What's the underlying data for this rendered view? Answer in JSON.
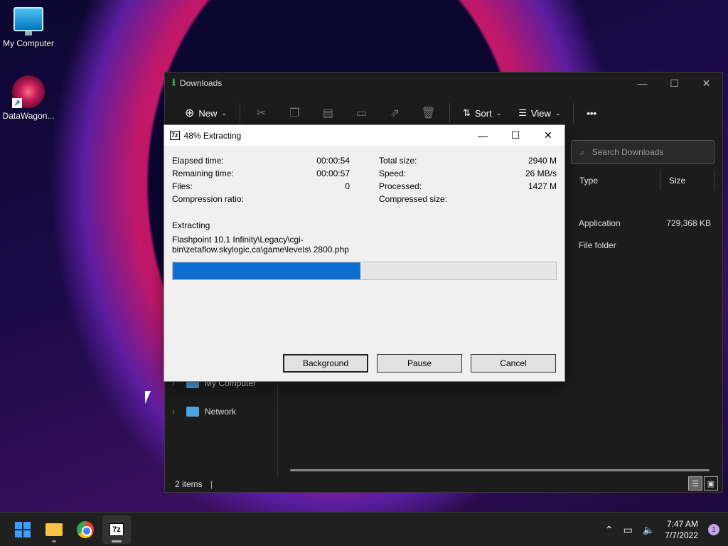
{
  "desktop": {
    "icons": [
      {
        "label": "My Computer"
      },
      {
        "label": "DataWagon..."
      }
    ]
  },
  "explorer": {
    "title": "Downloads",
    "toolbar": {
      "new_label": "New",
      "sort_label": "Sort",
      "view_label": "View",
      "more_label": "•••"
    },
    "search_placeholder": "Search Downloads",
    "columns": [
      "Type",
      "Size"
    ],
    "files": [
      {
        "type": "Application",
        "size": "729,368 KB"
      },
      {
        "type": "File folder",
        "size": ""
      }
    ],
    "nav": [
      {
        "label": "My Computer"
      },
      {
        "label": "Network"
      }
    ],
    "status": "2 items"
  },
  "dialog": {
    "title": "48% Extracting",
    "icon_text": "7z",
    "left_stats": [
      {
        "label": "Elapsed time:",
        "value": "00:00:54"
      },
      {
        "label": "Remaining time:",
        "value": "00:00:57"
      },
      {
        "label": "Files:",
        "value": "0"
      },
      {
        "label": "Compression ratio:",
        "value": ""
      }
    ],
    "right_stats": [
      {
        "label": "Total size:",
        "value": "2940 M"
      },
      {
        "label": "Speed:",
        "value": "26 MB/s"
      },
      {
        "label": "Processed:",
        "value": "1427 M"
      },
      {
        "label": "Compressed size:",
        "value": ""
      }
    ],
    "action_label": "Extracting",
    "current_path": "Flashpoint 10.1 Infinity\\Legacy\\cgi-bin\\zetaflow.skylogic.ca\\game\\levels\\ 2800.php",
    "progress_fraction": 0.49,
    "buttons": {
      "background": "Background",
      "pause": "Pause",
      "cancel": "Cancel"
    }
  },
  "taskbar": {
    "apps": [
      "start",
      "file-explorer",
      "chrome",
      "7-zip"
    ],
    "sevenz_label": "7z",
    "time": "7:47 AM",
    "date": "7/7/2022",
    "notifications": "1"
  },
  "colors": {
    "progress_fill": "#0a6fd1",
    "explorer_bg": "#1c1c1c",
    "taskbar_bg": "#202020"
  }
}
